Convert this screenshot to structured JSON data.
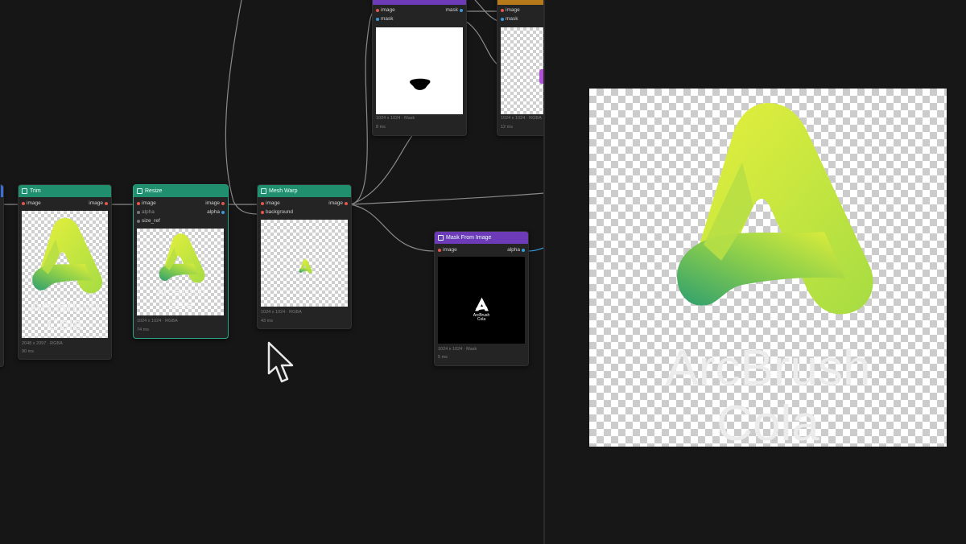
{
  "nodes": {
    "trim": {
      "title": "Trim",
      "input_image": "image",
      "output_image": "image",
      "thumb_line1": "ArcBrush",
      "thumb_line2": "Cola",
      "meta_size": "2048 x 2097 · RGBA",
      "meta_time": "90 ms"
    },
    "resize": {
      "title": "Resize",
      "input_image": "image",
      "input_alpha": "alpha",
      "input_size_ref": "size_ref",
      "output_image": "image",
      "output_alpha": "alpha",
      "thumb_line1": "ArcBrush",
      "thumb_line2": "Cola",
      "meta_size": "1024 x 1024 · RGBA",
      "meta_time": "74 ms"
    },
    "mesh_warp": {
      "title": "Mesh Warp",
      "input_image": "image",
      "input_background": "background",
      "output_image": "image",
      "meta_size": "1024 x 1024 · RGBA",
      "meta_time": "43 ms"
    },
    "mask_node": {
      "input_image": "image",
      "input_mask": "mask",
      "output_mask": "mask",
      "meta_size": "1024 x 1024 · Mask",
      "meta_time": "8 ms"
    },
    "orange_node": {
      "input_image": "image",
      "input_mask": "mask",
      "meta_size": "1024 x 1024 · RGBA",
      "meta_time": "12 ms"
    },
    "mask_from_image": {
      "title": "Mask From Image",
      "input_image": "image",
      "output_alpha": "alpha",
      "thumb_line1": "ArcBrush",
      "thumb_line2": "Cola",
      "meta_size": "1024 x 1024 · Mask",
      "meta_time": "5 ms"
    }
  },
  "preview": {
    "line1": "ArcBrush",
    "line2": "Cola"
  },
  "colors": {
    "canvas_bg": "#161616",
    "node_bg": "#242424",
    "header_green": "#1f8f6e",
    "header_purple": "#6d3bb8",
    "header_orange": "#b77a1a",
    "port_red": "#e2574c",
    "port_blue": "#3a9ad9",
    "selected_border": "#2fa58a",
    "logo_green_light": "#d8ec3a",
    "logo_green_dark": "#2e9f6f"
  },
  "icons": {
    "trim": "crop-icon",
    "resize": "resize-icon",
    "mask_from_image": "mask-icon",
    "cursor": "mouse-pointer-icon"
  }
}
